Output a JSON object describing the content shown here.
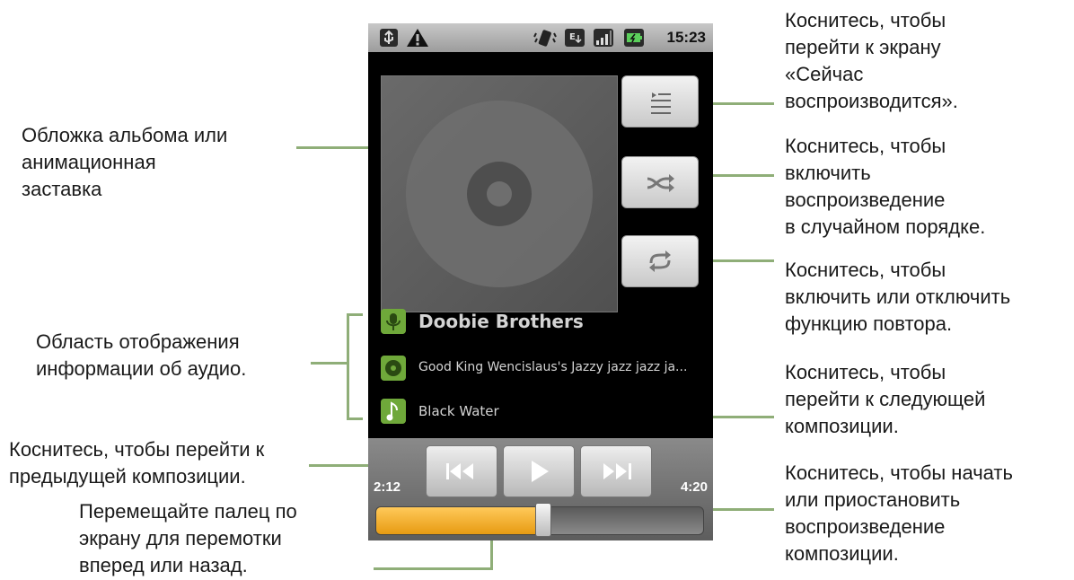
{
  "status_bar": {
    "time": "15:23",
    "icons": [
      "usb-icon",
      "warning-icon",
      "vibrate-icon",
      "edge-signal-icon",
      "signal-bars-icon",
      "battery-charging-icon"
    ]
  },
  "player": {
    "artist": "Doobie Brothers",
    "album": "Good King Wencislaus's Jazzy jazz jazz ja...",
    "track": "Black Water",
    "elapsed": "2:12",
    "duration": "4:20",
    "progress": 0.51,
    "buttons": [
      "now-playing-list",
      "shuffle",
      "repeat",
      "previous",
      "play",
      "next"
    ]
  },
  "annotations": {
    "album_art": "Обложка альбома или\nанимационная\nзаставка",
    "info_area": "Область отображения\nинформации об аудио.",
    "prev": "Коснитесь, чтобы перейти к\nпредыдущей композиции.",
    "seek": "Перемещайте палец по\nэкрану для перемотки\nвперед или назад.",
    "now_playing": "Коснитесь, чтобы\nперейти к экрану\n«Сейчас\nвоспроизводится».",
    "shuffle": "Коснитесь, чтобы\nвключить\nвоспроизведение\nв случайном порядке.",
    "repeat": "Коснитесь, чтобы\nвключить или отключить\nфункцию повтора.",
    "next": "Коснитесь, чтобы\nперейти к следующей\nкомпозиции.",
    "play": "Коснитесь, чтобы начать\nили приостановить\nвоспроизведение\nкомпозиции."
  },
  "colors": {
    "accent": "#6fa83a",
    "progress": "#f0aa2a",
    "callout_line": "#8fae78"
  }
}
